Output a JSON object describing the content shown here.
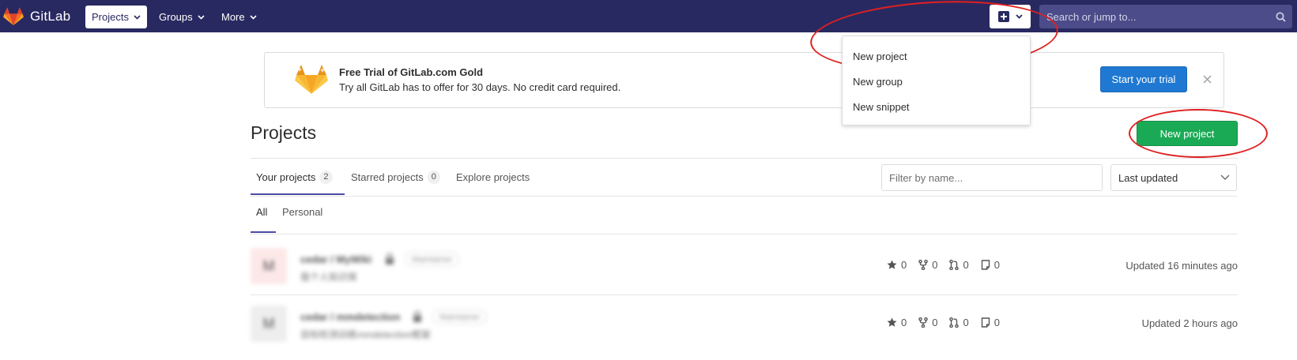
{
  "navbar": {
    "brand": "GitLab",
    "links": [
      {
        "label": "Projects",
        "active": true
      },
      {
        "label": "Groups",
        "active": false
      },
      {
        "label": "More",
        "active": false
      }
    ],
    "search_placeholder": "Search or jump to..."
  },
  "new_menu": {
    "items": [
      "New project",
      "New group",
      "New snippet"
    ]
  },
  "banner": {
    "title": "Free Trial of GitLab.com Gold",
    "text": "Try all GitLab has to offer for 30 days. No credit card required.",
    "button": "Start your trial"
  },
  "page": {
    "title": "Projects",
    "new_project_button": "New project"
  },
  "tabs": [
    {
      "label": "Your projects",
      "count": "2",
      "active": true
    },
    {
      "label": "Starred projects",
      "count": "0",
      "active": false
    },
    {
      "label": "Explore projects",
      "count": "",
      "active": false
    }
  ],
  "filter": {
    "placeholder": "Filter by name...",
    "sort_selected": "Last updated"
  },
  "subtabs": [
    {
      "label": "All",
      "active": true
    },
    {
      "label": "Personal",
      "active": false
    }
  ],
  "projects": [
    {
      "avatar_letter": "M",
      "avatar_color": "#fde8e8",
      "name": "cedar / MyWiki",
      "role": "Maintainer",
      "description": "我个人知识库",
      "stars": "0",
      "forks": "0",
      "merge_requests": "0",
      "issues": "0",
      "updated": "Updated 16 minutes ago"
    },
    {
      "avatar_letter": "M",
      "avatar_color": "#eeeeee",
      "name": "cedar / mmdetection",
      "role": "Maintainer",
      "description": "目标检测训练mmdetection框架",
      "stars": "0",
      "forks": "0",
      "merge_requests": "0",
      "issues": "0",
      "updated": "Updated 2 hours ago"
    }
  ],
  "colors": {
    "navbar": "#292961",
    "primary": "#1f78d1",
    "success": "#1aaa55",
    "annotation": "#e02020",
    "tab_active": "#4b4ba3"
  }
}
